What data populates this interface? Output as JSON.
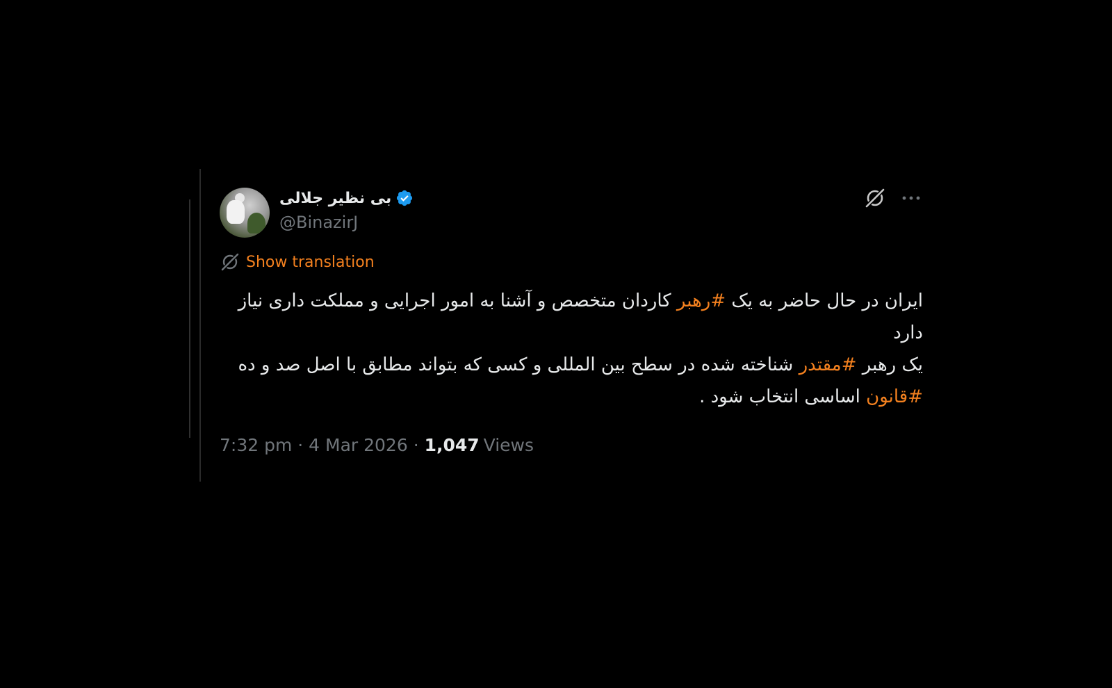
{
  "author": {
    "display_name": "بی نظیر جلالی",
    "handle": "@BinazirJ",
    "verified": true
  },
  "translation": {
    "label": "Show translation"
  },
  "body": {
    "lines": [
      [
        {
          "text": "ایران در حال حاضر به یک ",
          "hashtag": false
        },
        {
          "text": "#رهبر",
          "hashtag": true
        },
        {
          "text": " کاردان متخصص و آشنا به امور اجرایی و مملکت داری نیاز دارد",
          "hashtag": false
        }
      ],
      [
        {
          "text": "یک رهبر ",
          "hashtag": false
        },
        {
          "text": "#مقتدر",
          "hashtag": true
        },
        {
          "text": " شناخته شده در سطح بین المللی و کسی که بتواند مطابق با اصل صد و ده ",
          "hashtag": false
        },
        {
          "text": "#قانون",
          "hashtag": true
        },
        {
          "text": " اساسی انتخاب شود .",
          "hashtag": false
        }
      ]
    ]
  },
  "meta": {
    "time": "7:32 pm",
    "separator": " · ",
    "date": "4 Mar 2026",
    "views_count": "1,047",
    "views_label": "Views"
  },
  "colors": {
    "background": "#000000",
    "accent": "#f4811f",
    "text": "#e7e9ea",
    "muted": "#71767b",
    "verified": "#1d9bf0"
  },
  "icons": {
    "verified": "verified-badge-icon",
    "grok": "grok-icon",
    "more": "more-icon",
    "translate": "translate-icon"
  }
}
